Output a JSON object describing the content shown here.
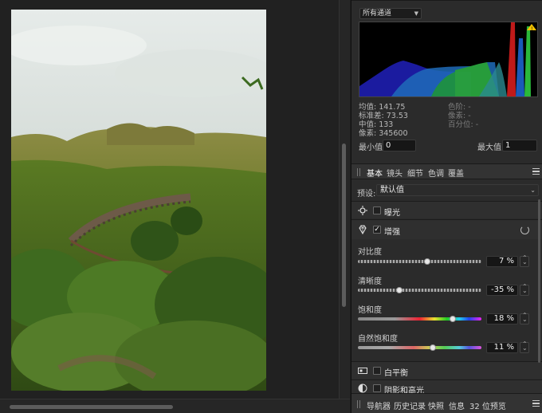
{
  "histogram": {
    "channel": "所有通道",
    "stats_left": [
      "均值: 141.75",
      "标准差: 73.53",
      "中值: 133",
      "像素: 345600"
    ],
    "stats_right": [
      "色阶: -",
      "像素: -",
      "百分位: -"
    ],
    "min_label": "最小值:",
    "min_value": "0",
    "max_label": "最大值:",
    "max_value": "1"
  },
  "tabs": [
    "基本",
    "镜头",
    "细节",
    "色调",
    "覆盖"
  ],
  "preset": {
    "label": "预设:",
    "value": "默认值"
  },
  "sections": {
    "exposure": {
      "label": "曝光",
      "checked": false,
      "icon": "sun-icon"
    },
    "enhance": {
      "label": "增强",
      "checked": true,
      "icon": "diamond-icon"
    },
    "white_balance": {
      "label": "白平衡",
      "checked": false,
      "icon": "white-balance-icon"
    },
    "shadows": {
      "label": "阴影和高光",
      "checked": false,
      "icon": "shadow-icon"
    }
  },
  "sliders": [
    {
      "label": "对比度",
      "value": "7 %",
      "percent": 7
    },
    {
      "label": "清晰度",
      "value": "-35 %",
      "percent": -35
    },
    {
      "label": "饱和度",
      "value": "18 %",
      "percent": 18
    },
    {
      "label": "自然饱和度",
      "value": "11 %",
      "percent": 11
    }
  ],
  "bottom_tabs": [
    "导航器",
    "历史记录",
    "快照",
    "信息",
    "32 位预览"
  ],
  "colors": {
    "panel_bg": "#2b2b2b",
    "section_bg": "#2f2f2f",
    "warning": "#f2c200"
  }
}
